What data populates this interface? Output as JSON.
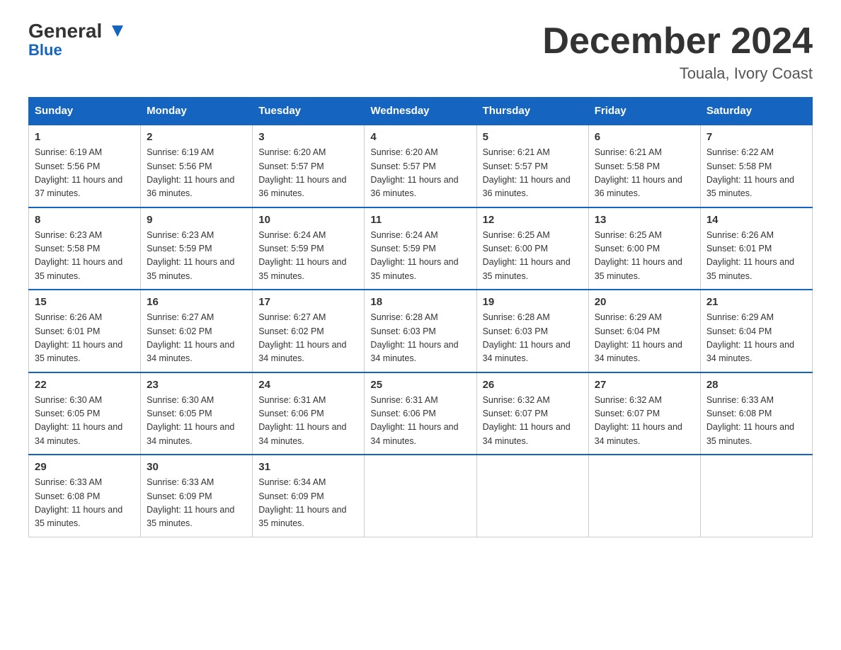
{
  "header": {
    "logo_general": "General",
    "logo_blue": "Blue",
    "month_year": "December 2024",
    "location": "Touala, Ivory Coast"
  },
  "days_of_week": [
    "Sunday",
    "Monday",
    "Tuesday",
    "Wednesday",
    "Thursday",
    "Friday",
    "Saturday"
  ],
  "weeks": [
    [
      {
        "num": "1",
        "sunrise": "6:19 AM",
        "sunset": "5:56 PM",
        "daylight": "11 hours and 37 minutes."
      },
      {
        "num": "2",
        "sunrise": "6:19 AM",
        "sunset": "5:56 PM",
        "daylight": "11 hours and 36 minutes."
      },
      {
        "num": "3",
        "sunrise": "6:20 AM",
        "sunset": "5:57 PM",
        "daylight": "11 hours and 36 minutes."
      },
      {
        "num": "4",
        "sunrise": "6:20 AM",
        "sunset": "5:57 PM",
        "daylight": "11 hours and 36 minutes."
      },
      {
        "num": "5",
        "sunrise": "6:21 AM",
        "sunset": "5:57 PM",
        "daylight": "11 hours and 36 minutes."
      },
      {
        "num": "6",
        "sunrise": "6:21 AM",
        "sunset": "5:58 PM",
        "daylight": "11 hours and 36 minutes."
      },
      {
        "num": "7",
        "sunrise": "6:22 AM",
        "sunset": "5:58 PM",
        "daylight": "11 hours and 35 minutes."
      }
    ],
    [
      {
        "num": "8",
        "sunrise": "6:23 AM",
        "sunset": "5:58 PM",
        "daylight": "11 hours and 35 minutes."
      },
      {
        "num": "9",
        "sunrise": "6:23 AM",
        "sunset": "5:59 PM",
        "daylight": "11 hours and 35 minutes."
      },
      {
        "num": "10",
        "sunrise": "6:24 AM",
        "sunset": "5:59 PM",
        "daylight": "11 hours and 35 minutes."
      },
      {
        "num": "11",
        "sunrise": "6:24 AM",
        "sunset": "5:59 PM",
        "daylight": "11 hours and 35 minutes."
      },
      {
        "num": "12",
        "sunrise": "6:25 AM",
        "sunset": "6:00 PM",
        "daylight": "11 hours and 35 minutes."
      },
      {
        "num": "13",
        "sunrise": "6:25 AM",
        "sunset": "6:00 PM",
        "daylight": "11 hours and 35 minutes."
      },
      {
        "num": "14",
        "sunrise": "6:26 AM",
        "sunset": "6:01 PM",
        "daylight": "11 hours and 35 minutes."
      }
    ],
    [
      {
        "num": "15",
        "sunrise": "6:26 AM",
        "sunset": "6:01 PM",
        "daylight": "11 hours and 35 minutes."
      },
      {
        "num": "16",
        "sunrise": "6:27 AM",
        "sunset": "6:02 PM",
        "daylight": "11 hours and 34 minutes."
      },
      {
        "num": "17",
        "sunrise": "6:27 AM",
        "sunset": "6:02 PM",
        "daylight": "11 hours and 34 minutes."
      },
      {
        "num": "18",
        "sunrise": "6:28 AM",
        "sunset": "6:03 PM",
        "daylight": "11 hours and 34 minutes."
      },
      {
        "num": "19",
        "sunrise": "6:28 AM",
        "sunset": "6:03 PM",
        "daylight": "11 hours and 34 minutes."
      },
      {
        "num": "20",
        "sunrise": "6:29 AM",
        "sunset": "6:04 PM",
        "daylight": "11 hours and 34 minutes."
      },
      {
        "num": "21",
        "sunrise": "6:29 AM",
        "sunset": "6:04 PM",
        "daylight": "11 hours and 34 minutes."
      }
    ],
    [
      {
        "num": "22",
        "sunrise": "6:30 AM",
        "sunset": "6:05 PM",
        "daylight": "11 hours and 34 minutes."
      },
      {
        "num": "23",
        "sunrise": "6:30 AM",
        "sunset": "6:05 PM",
        "daylight": "11 hours and 34 minutes."
      },
      {
        "num": "24",
        "sunrise": "6:31 AM",
        "sunset": "6:06 PM",
        "daylight": "11 hours and 34 minutes."
      },
      {
        "num": "25",
        "sunrise": "6:31 AM",
        "sunset": "6:06 PM",
        "daylight": "11 hours and 34 minutes."
      },
      {
        "num": "26",
        "sunrise": "6:32 AM",
        "sunset": "6:07 PM",
        "daylight": "11 hours and 34 minutes."
      },
      {
        "num": "27",
        "sunrise": "6:32 AM",
        "sunset": "6:07 PM",
        "daylight": "11 hours and 34 minutes."
      },
      {
        "num": "28",
        "sunrise": "6:33 AM",
        "sunset": "6:08 PM",
        "daylight": "11 hours and 35 minutes."
      }
    ],
    [
      {
        "num": "29",
        "sunrise": "6:33 AM",
        "sunset": "6:08 PM",
        "daylight": "11 hours and 35 minutes."
      },
      {
        "num": "30",
        "sunrise": "6:33 AM",
        "sunset": "6:09 PM",
        "daylight": "11 hours and 35 minutes."
      },
      {
        "num": "31",
        "sunrise": "6:34 AM",
        "sunset": "6:09 PM",
        "daylight": "11 hours and 35 minutes."
      },
      null,
      null,
      null,
      null
    ]
  ]
}
